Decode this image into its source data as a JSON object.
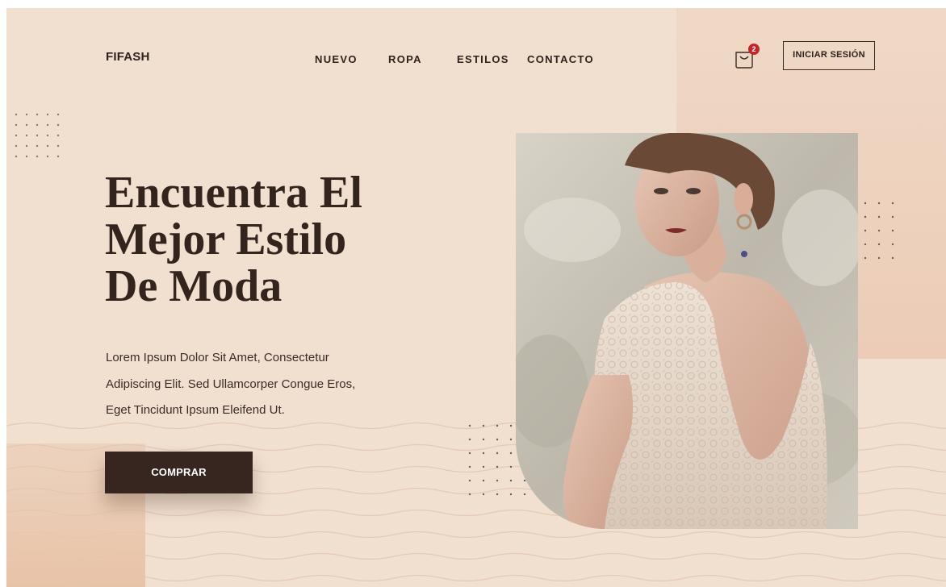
{
  "header": {
    "logo": "FIFASH",
    "nav": [
      "NUEVO",
      "ROPA",
      "ESTILOS",
      "CONTACTO"
    ],
    "cart_count": "2",
    "login_label": "INICIAR SESIÓN"
  },
  "hero": {
    "title_lines": [
      "Encuentra El",
      "Mejor Estilo",
      "De Moda"
    ],
    "description_lines": [
      "Lorem Ipsum Dolor Sit Amet, Consectetur",
      "Adipiscing Elit. Sed Ullamcorper Congue Eros,",
      "Eget Tincidunt Ipsum Eleifend Ut."
    ],
    "cta_label": "COMPRAR"
  },
  "icons": {
    "cart": "shopping-bag-icon",
    "photo": "model-photo"
  },
  "colors": {
    "background": "#f1dfcf",
    "dark": "#37261f",
    "badge": "#c3262a"
  }
}
